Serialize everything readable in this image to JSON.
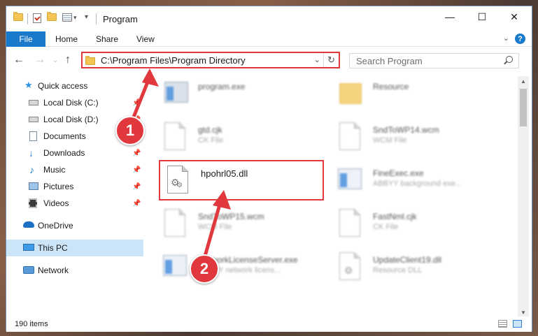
{
  "window": {
    "title": "Program",
    "controls": {
      "minimize": "—",
      "maximize": "☐",
      "close": "✕"
    }
  },
  "ribbon": {
    "tabs": [
      "File",
      "Home",
      "Share",
      "View"
    ],
    "help": "?"
  },
  "address_bar": {
    "path": "C:\\Program Files\\Program Directory"
  },
  "search": {
    "placeholder": "Search Program"
  },
  "sidebar": {
    "items": [
      {
        "label": "Quick access",
        "icon": "star-icon"
      },
      {
        "label": "Local Disk (C:)",
        "icon": "drive-icon",
        "pinned": true
      },
      {
        "label": "Local Disk (D:)",
        "icon": "drive-icon",
        "pinned": true
      },
      {
        "label": "Documents",
        "icon": "documents-icon",
        "pinned": true
      },
      {
        "label": "Downloads",
        "icon": "download-icon",
        "pinned": true
      },
      {
        "label": "Music",
        "icon": "music-icon",
        "pinned": true
      },
      {
        "label": "Pictures",
        "icon": "pictures-icon",
        "pinned": true
      },
      {
        "label": "Videos",
        "icon": "videos-icon",
        "pinned": true
      },
      {
        "label": "OneDrive",
        "icon": "cloud-icon"
      },
      {
        "label": "This PC",
        "icon": "computer-icon",
        "selected": true
      },
      {
        "label": "Network",
        "icon": "network-icon"
      }
    ]
  },
  "files": [
    {
      "name": "program.exe",
      "type": "",
      "icon": "installer-icon"
    },
    {
      "name": "Resource",
      "type": "",
      "icon": "folder-icon"
    },
    {
      "name": "gtd.cjk",
      "type": "CK File",
      "icon": "document-icon"
    },
    {
      "name": "SndToWP14.wcm",
      "type": "WCM File",
      "icon": "document-icon"
    },
    {
      "name": "hpohrl05.dll",
      "type": "",
      "icon": "dll-gear-icon",
      "highlighted": true
    },
    {
      "name": "FineExec.exe",
      "type": "ABBYY background exe...",
      "icon": "application-icon"
    },
    {
      "name": "SndToWP15.wcm",
      "type": "WCM File",
      "icon": "document-icon"
    },
    {
      "name": "FastNml.cjk",
      "type": "CK File",
      "icon": "document-icon"
    },
    {
      "name": "NetworkLicenseServer.exe",
      "type": "ABBYY network licens...",
      "icon": "application-icon"
    },
    {
      "name": "UpdateClient19.dll",
      "type": "Resource DLL",
      "icon": "dll-gear-icon"
    }
  ],
  "status": {
    "count": "190 items"
  },
  "annotations": {
    "step1": "1",
    "step2": "2",
    "color": "#e0383d"
  }
}
